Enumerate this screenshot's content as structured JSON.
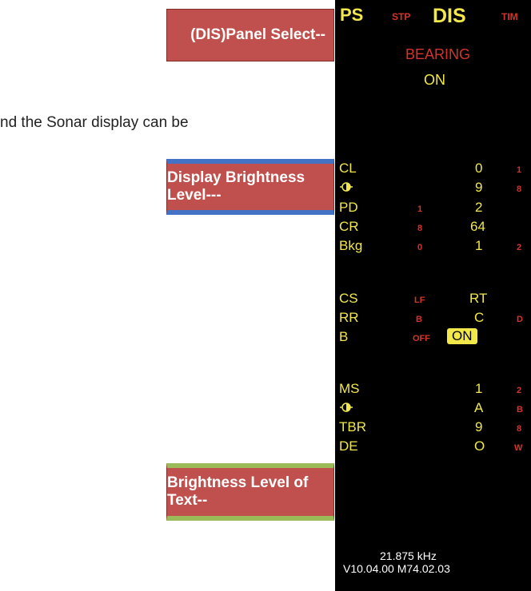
{
  "callouts": {
    "panel_select": "(DIS)Panel Select--",
    "display_brightness": "Display Brightness Level---",
    "text_brightness": "Brightness Level of Text--"
  },
  "doc_text": "nd the Sonar display can be",
  "header": {
    "ps": "PS",
    "stp": "STP",
    "dis": "DIS",
    "tim": "TIM",
    "bearing": "BEARING",
    "bearing_state": "ON"
  },
  "rows": {
    "cl": {
      "label": "CL",
      "value": "0",
      "right": "1"
    },
    "bright1": {
      "icon": "brightness-icon",
      "value": "9",
      "right": "8"
    },
    "pd": {
      "label": "PD",
      "left": "1",
      "value": "2"
    },
    "cr": {
      "label": "CR",
      "left": "8",
      "value": "64"
    },
    "bkg": {
      "label": "Bkg",
      "left": "0",
      "value": "1",
      "right": "2"
    },
    "cs": {
      "label": "CS",
      "left": "LF",
      "value": "RT"
    },
    "rr": {
      "label": "RR",
      "left": "B",
      "value": "C",
      "right": "D"
    },
    "b": {
      "label": "B",
      "left": "OFF",
      "value": "ON"
    },
    "ms": {
      "label": "MS",
      "value": "1",
      "right": "2"
    },
    "bright2": {
      "icon": "brightness-icon",
      "value": "A",
      "right": "B"
    },
    "tbr": {
      "label": "TBR",
      "value": "9",
      "right": "8"
    },
    "de": {
      "label": "DE",
      "value": "O",
      "right": "W"
    }
  },
  "footer": {
    "freq": "21.875  kHz",
    "version": "V10.04.00  M74.02.03"
  },
  "colors": {
    "panel_bg": "#000000",
    "text_yellow": "#f2e84a",
    "text_red": "#d5342b",
    "callout_red": "#c0504d",
    "blue": "#4472c4",
    "green": "#9bbb59"
  }
}
